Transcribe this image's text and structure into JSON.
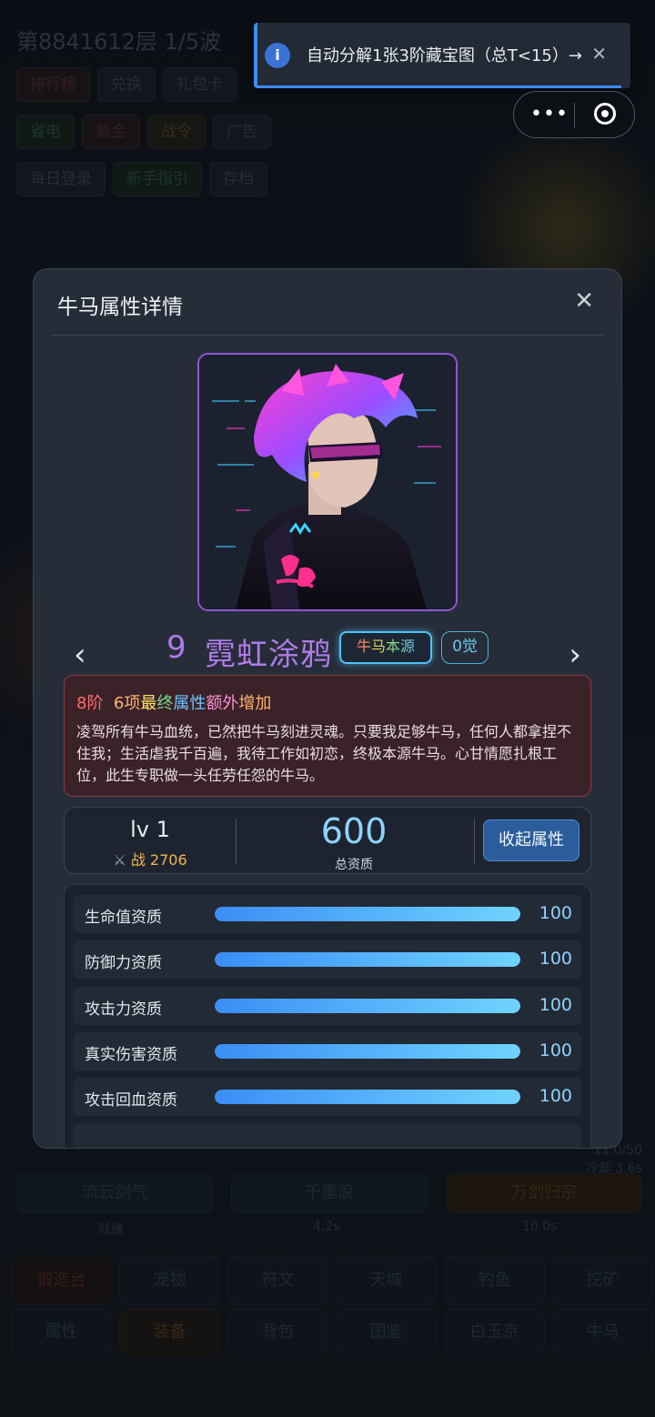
{
  "background": {
    "title": "第8841612层  1/5波",
    "row1": [
      "排行榜",
      "兑换",
      "礼包卡"
    ],
    "row2": [
      "省电",
      "氪金",
      "战令",
      "广告"
    ],
    "row3": [
      "每日登录",
      "新手指引",
      "存档"
    ],
    "skills": [
      "流云剑气",
      "千重浪",
      "万剑归宗"
    ],
    "skill_subs": [
      "就绪",
      "4.2s",
      "10.0s"
    ],
    "side_right": [
      "11.0/50",
      "冷却 3.6s"
    ],
    "nav_row1": [
      "锻造台",
      "宠物",
      "符文",
      "天域",
      "钓鱼",
      "挖矿"
    ],
    "nav_row2": [
      "属性",
      "装备",
      "背包",
      "图鉴",
      "白玉京",
      "牛马"
    ]
  },
  "toast": {
    "icon": "info-icon",
    "message": "自动分解1张3阶藏宝图（总T<15）→",
    "close": "✕"
  },
  "capsule": {
    "more": "•••",
    "target_icon": "target-icon"
  },
  "modal": {
    "title": "牛马属性详情",
    "close": "✕",
    "prev": "‹",
    "next": "›",
    "character": {
      "number": "9",
      "name": "霓虹涂鸦",
      "tag": "牛马本源",
      "awaken": "0觉"
    },
    "desc": {
      "tier": "8阶",
      "bonus_parts": [
        "6项",
        "最",
        "终",
        "属",
        "性",
        "额外",
        "增加"
      ],
      "text": "凌驾所有牛马血统，已然把牛马刻进灵魂。只要我足够牛马，任何人都拿捏不住我；生活虐我千百遍，我待工作如初恋，终极本源牛马。心甘情愿扎根工位，此生专职做一头任劳任怨的牛马。"
    },
    "stats": {
      "level": "lv 1",
      "power_icon": "⚔",
      "power_label": "战 2706",
      "total": "600",
      "total_label": "总资质",
      "collapse_button": "收起属性"
    },
    "attributes": [
      {
        "label": "生命值资质",
        "value": "100",
        "fill": 1.0
      },
      {
        "label": "防御力资质",
        "value": "100",
        "fill": 1.0
      },
      {
        "label": "攻击力资质",
        "value": "100",
        "fill": 1.0
      },
      {
        "label": "真实伤害资质",
        "value": "100",
        "fill": 1.0
      },
      {
        "label": "攻击回血资质",
        "value": "100",
        "fill": 1.0
      }
    ]
  }
}
